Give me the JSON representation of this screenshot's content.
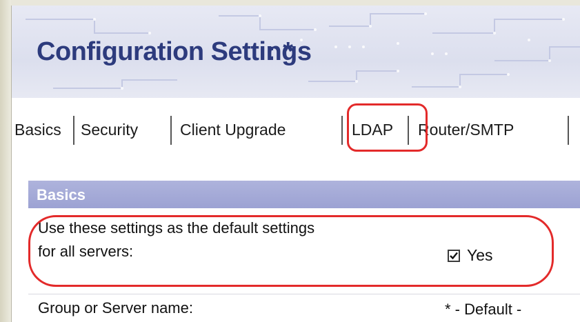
{
  "header": {
    "title": "Configuration Settings",
    "title_suffix": ": *"
  },
  "tabs": [
    {
      "label": "Basics",
      "active": true
    },
    {
      "label": "Security",
      "active": false
    },
    {
      "label": "Client Upgrade",
      "active": false
    },
    {
      "label": "LDAP",
      "active": false,
      "highlighted": true
    },
    {
      "label": "Router/SMTP",
      "active": false
    }
  ],
  "section": {
    "title": "Basics"
  },
  "fields": {
    "default_settings": {
      "label_line1": "Use these settings as the default settings",
      "label_line2": "for all servers:",
      "checked": true,
      "value_label": "Yes"
    },
    "group_name": {
      "label": "Group or Server name:",
      "value": "* - Default -"
    }
  },
  "colors": {
    "title": "#2d3b7d",
    "section_bar": "#a4a9d7",
    "highlight": "#e32a2a",
    "frame": "#e3e1d2"
  }
}
